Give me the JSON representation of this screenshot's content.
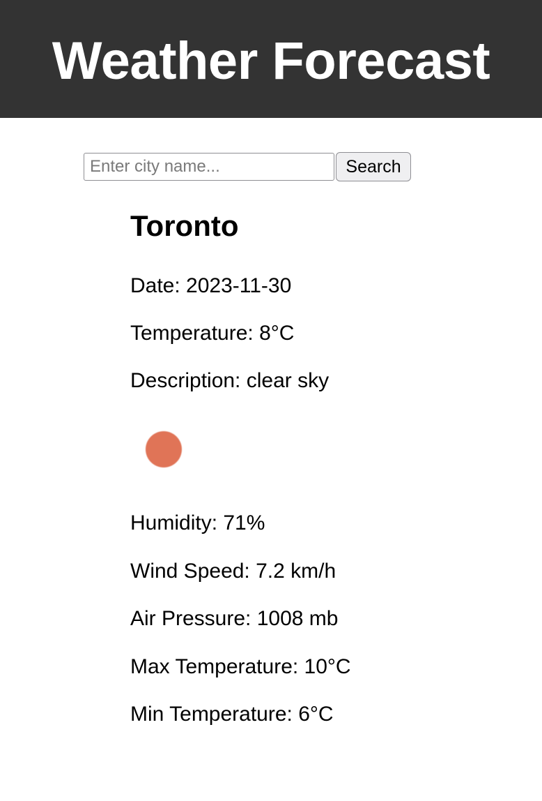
{
  "header": {
    "title": "Weather Forecast"
  },
  "search": {
    "placeholder": "Enter city name...",
    "value": "",
    "button_label": "Search"
  },
  "weather": {
    "city": "Toronto",
    "date": "Date: 2023-11-30",
    "temperature": "Temperature: 8°C",
    "description": "Description: clear sky",
    "icon": "clear-sky-sun-icon",
    "icon_color": "#e07457",
    "humidity": "Humidity: 71%",
    "wind_speed": "Wind Speed: 7.2 km/h",
    "air_pressure": "Air Pressure: 1008 mb",
    "max_temperature": "Max Temperature: 10°C",
    "min_temperature": "Min Temperature: 6°C"
  },
  "colors": {
    "header_bg": "#333333",
    "header_text": "#ffffff",
    "page_bg": "#ffffff"
  }
}
